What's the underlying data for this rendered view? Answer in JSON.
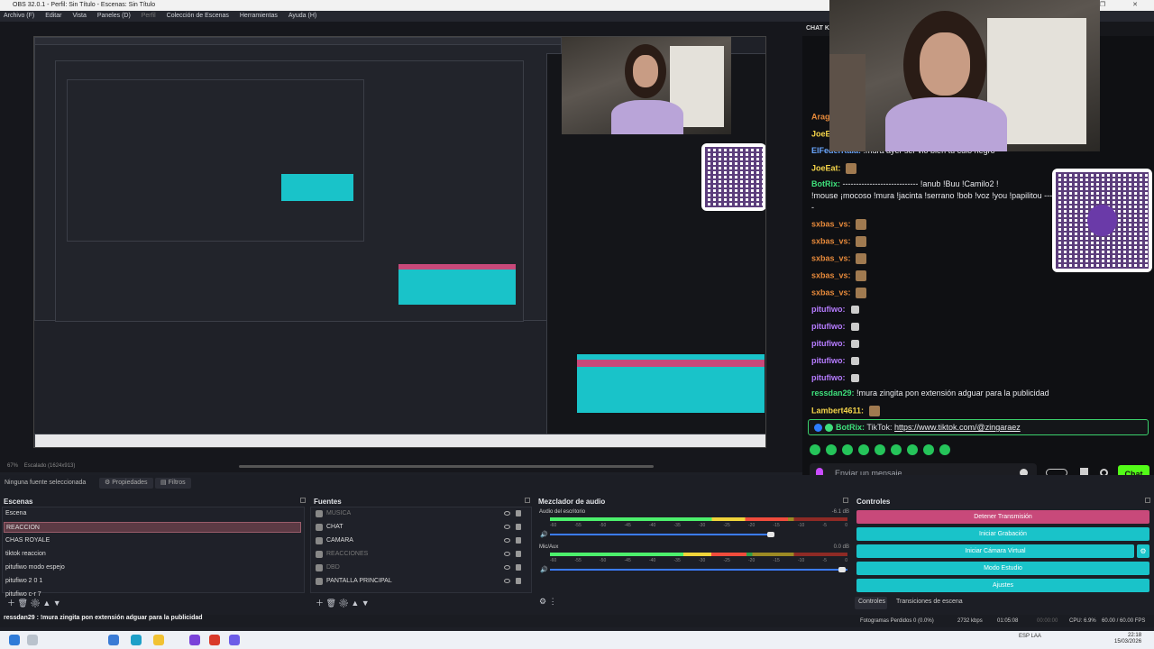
{
  "window": {
    "title": "OBS 32.0.1 - Perfil: Sin Título - Escenas: Sin Título",
    "controls": "— ❐ ✕"
  },
  "menu": [
    "Archivo (F)",
    "Editar",
    "Vista",
    "Paneles (D)",
    "Perfil",
    "Colección de Escenas",
    "Herramientas",
    "Ayuda (H)"
  ],
  "preview": {
    "zoom": "67%",
    "scale_label": "Escalado (1624x913)"
  },
  "source_toolbar": {
    "none_selected": "Ninguna fuente seleccionada",
    "properties": "Propiedades",
    "filters": "Filtros"
  },
  "chat": {
    "header": "CHAT KI",
    "lines": [
      {
        "user": "Arago",
        "cls": "u-orange",
        "msg": ""
      },
      {
        "user": "JoeEa",
        "cls": "u-yellow",
        "msg": ""
      },
      {
        "user": "ElFederKaia:",
        "cls": "u-blue",
        "msg": "!mura ayer ser vio bien tu culo negro"
      },
      {
        "user": "JoeEat:",
        "cls": "u-yellow",
        "msg": ""
      },
      {
        "user": "BotRix:",
        "cls": "u-green",
        "msg": "---------------------------- !anub !Buu !Camilo2 !"
      },
      {
        "user": "",
        "cls": "",
        "msg": "!mouse ¡mocoso !mura !jacinta !serrano !bob !voz !you !papilitou -----"
      },
      {
        "user": "",
        "cls": "",
        "msg": "-"
      },
      {
        "user": "sxbas_vs:",
        "cls": "u-orange",
        "msg": ""
      },
      {
        "user": "sxbas_vs:",
        "cls": "u-orange",
        "msg": ""
      },
      {
        "user": "sxbas_vs:",
        "cls": "u-orange",
        "msg": ""
      },
      {
        "user": "sxbas_vs:",
        "cls": "u-orange",
        "msg": ""
      },
      {
        "user": "sxbas_vs:",
        "cls": "u-orange",
        "msg": ""
      },
      {
        "user": "pitufiwo:",
        "cls": "u-purple",
        "msg": ""
      },
      {
        "user": "pitufiwo:",
        "cls": "u-purple",
        "msg": ""
      },
      {
        "user": "pitufiwo:",
        "cls": "u-purple",
        "msg": ""
      },
      {
        "user": "pitufiwo:",
        "cls": "u-purple",
        "msg": ""
      },
      {
        "user": "pitufiwo:",
        "cls": "u-purple",
        "msg": ""
      },
      {
        "user": "ressdan29:",
        "cls": "u-green",
        "msg": "!mura zingita pon extensión adguar para la publicidad"
      },
      {
        "user": "Lambert4611:",
        "cls": "u-yellow",
        "msg": ""
      }
    ],
    "pinned_user": "BotRix:",
    "pinned_text": "TikTok:",
    "pinned_link": "https://www.tiktok.com/@zingaraez",
    "input_placeholder": "Enviar un mensaje",
    "send_label": "Chat"
  },
  "docks": {
    "scenes": {
      "title": "Escenas",
      "items": [
        "Escena",
        "REACCION",
        "CHAS ROYALE",
        "tiktok reaccion",
        "pitufiwo modo espejo",
        "pitufiwo 2 0 1",
        "pitufiwo c-r 7"
      ],
      "selected": 1
    },
    "sources": {
      "title": "Fuentes",
      "items": [
        {
          "name": "MUSICA",
          "dim": true
        },
        {
          "name": "CHAT",
          "dim": false
        },
        {
          "name": "CAMARA",
          "dim": false
        },
        {
          "name": "REACCIONES",
          "dim": true
        },
        {
          "name": "DBD",
          "dim": true
        },
        {
          "name": "PANTALLA PRINCIPAL",
          "dim": false
        }
      ]
    },
    "mixer": {
      "title": "Mezclador de audio",
      "channels": [
        {
          "name": "Audio del escritorio",
          "db": "-6.1 dB",
          "level": 0.8
        },
        {
          "name": "Mic/Aux",
          "db": "0.0 dB",
          "level": 0.66
        }
      ],
      "ticks": [
        "-60",
        "-55",
        "-50",
        "-45",
        "-40",
        "-35",
        "-30",
        "-25",
        "-20",
        "-15",
        "-10",
        "-5",
        "0"
      ]
    },
    "controls": {
      "title": "Controles",
      "buttons": [
        "Detener Transmisión",
        "Iniciar Grabación",
        "Iniciar Cámara Virtual",
        "Modo Estudio",
        "Ajustes"
      ],
      "tabs": [
        "Controles",
        "Transiciones de escena"
      ]
    }
  },
  "overlay_chat_line": "ressdan29 : !mura zingita pon extensión adguar para la publicidad",
  "statusbar": {
    "frames_lost": "Fotogramas Perdidos 0 (0.0%)",
    "bitrate": "2732 kbps",
    "live_time": "01:05:08",
    "rec_time": "00:00:00",
    "cpu": "CPU: 6.9%",
    "fps": "60.00 / 60.00 FPS"
  },
  "taskbar": {
    "tray": "ESP LAA",
    "time": "22:18",
    "date": "15/03/2026"
  },
  "colors": {
    "accent_teal": "#19c3c9",
    "stop_pink": "#c8497a",
    "kick_green": "#53fc18"
  }
}
